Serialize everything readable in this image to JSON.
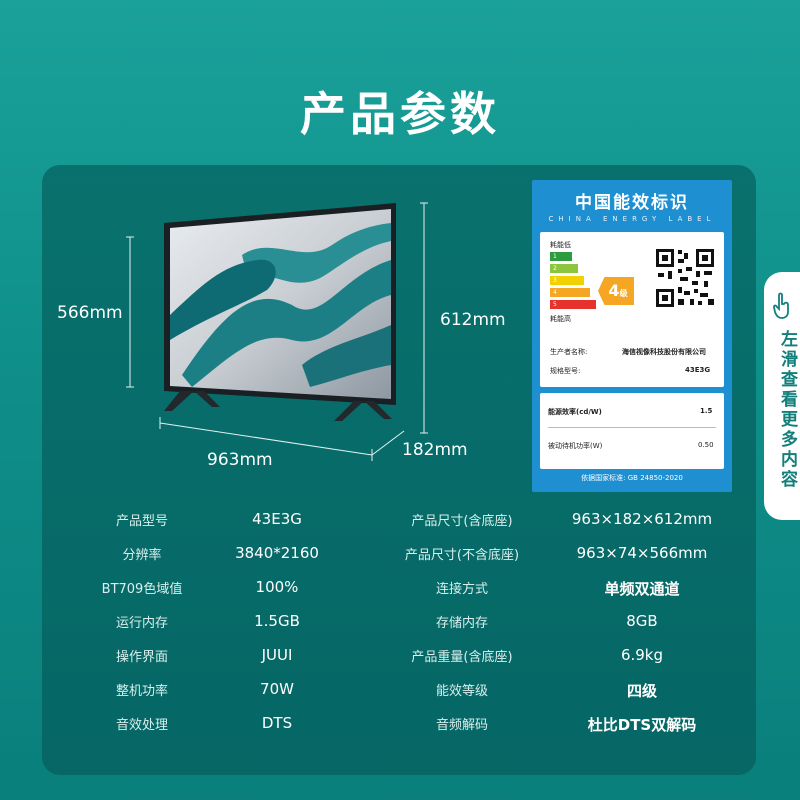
{
  "page_title": "产品参数",
  "dimensions": {
    "screen_height": "566mm",
    "total_height": "612mm",
    "width": "963mm",
    "depth": "182mm"
  },
  "energy_label": {
    "title": "中国能效标识",
    "subtitle": "CHINA ENERGY LABEL",
    "low_consumption": "耗能低",
    "high_consumption": "耗能高",
    "grades": [
      "1",
      "2",
      "3",
      "4",
      "5"
    ],
    "grade": "4",
    "grade_unit": "级",
    "manufacturer_label": "生产者名称:",
    "manufacturer_value": "海信视像科技股份有限公司",
    "model_label": "规格型号:",
    "model_value": "43E3G",
    "efficiency_label": "能源效率(cd/W)",
    "efficiency_value": "1.5",
    "standby_label": "被动待机功率(W)",
    "standby_value": "0.50",
    "standard": "依据国家标准: GB 24850-2020"
  },
  "specs": [
    {
      "label1": "产品型号",
      "value1": "43E3G",
      "label2": "产品尺寸(含底座)",
      "value2": "963×182×612mm"
    },
    {
      "label1": "分辨率",
      "value1": "3840*2160",
      "label2": "产品尺寸(不含底座)",
      "value2": "963×74×566mm"
    },
    {
      "label1": "BT709色域值",
      "value1": "100%",
      "label2": "连接方式",
      "value2": "单频双通道"
    },
    {
      "label1": "运行内存",
      "value1": "1.5GB",
      "label2": "存储内存",
      "value2": "8GB"
    },
    {
      "label1": "操作界面",
      "value1": "JUUI",
      "label2": "产品重量(含底座)",
      "value2": "6.9kg"
    },
    {
      "label1": "整机功率",
      "value1": "70W",
      "label2": "能效等级",
      "value2": "四级"
    },
    {
      "label1": "音效处理",
      "value1": "DTS",
      "label2": "音频解码",
      "value2": "杜比DTS双解码"
    }
  ],
  "side_tab": {
    "text": "左滑查看更多内容",
    "icon": "hand-swipe-icon"
  },
  "colors": {
    "background": "#13988f",
    "card": "#0c5f5d",
    "energy_blue": "#1e8fd0",
    "grade_orange": "#f5a623"
  }
}
